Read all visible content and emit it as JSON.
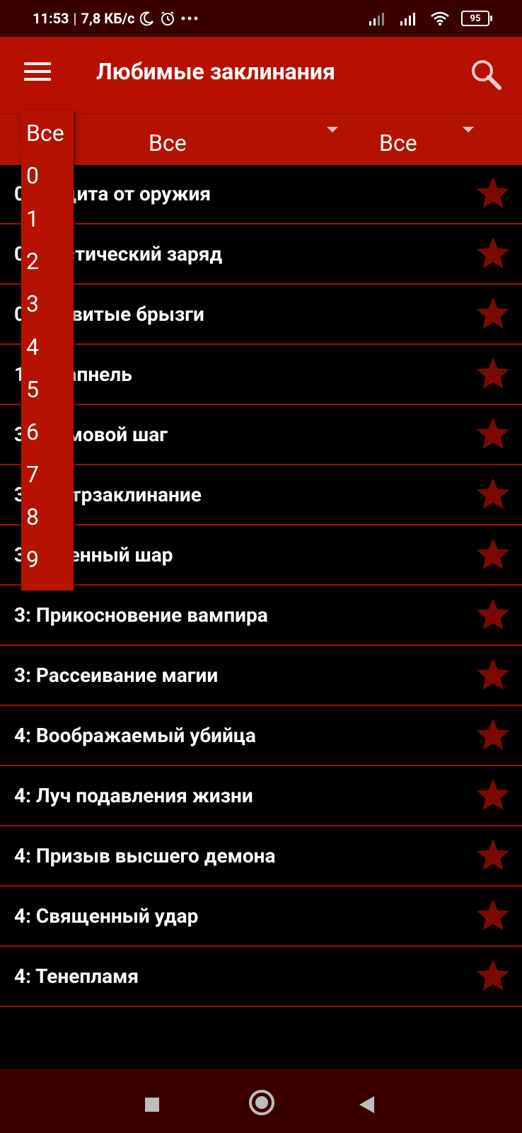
{
  "status_bar": {
    "time": "11:53",
    "separator": "|",
    "network_speed": "7,8 КБ/с",
    "battery": "95"
  },
  "app_bar": {
    "title": "Любимые заклинания"
  },
  "filters": {
    "level_value": "Все",
    "class_value": "Все"
  },
  "dropdown": {
    "items": [
      "Все",
      "0",
      "1",
      "2",
      "3",
      "4",
      "5",
      "6",
      "7",
      "8",
      "9"
    ]
  },
  "spells": [
    {
      "label": "0: Защита от оружия",
      "starred": true
    },
    {
      "label": "0: Мистический заряд",
      "starred": true
    },
    {
      "label": "0: Ядовитые брызги",
      "starred": true
    },
    {
      "label": "1: Шрапнель",
      "starred": true
    },
    {
      "label": "3: Громовой шаг",
      "starred": true
    },
    {
      "label": "3: Контрзаклинание",
      "starred": true
    },
    {
      "label": "3: Огненный шар",
      "starred": true
    },
    {
      "label": "3: Прикосновение вампира",
      "starred": true
    },
    {
      "label": "3: Рассеивание магии",
      "starred": true
    },
    {
      "label": "4: Воображаемый убийца",
      "starred": true
    },
    {
      "label": "4: Луч подавления жизни",
      "starred": true
    },
    {
      "label": "4: Призыв высшего демона",
      "starred": true
    },
    {
      "label": "4: Священный удар",
      "starred": true
    },
    {
      "label": "4: Тенепламя",
      "starred": true
    }
  ],
  "colors": {
    "app_bar": "#b81000",
    "star": "#7a0a00",
    "divider": "#a01000",
    "nav_bar": "#3a0000"
  }
}
